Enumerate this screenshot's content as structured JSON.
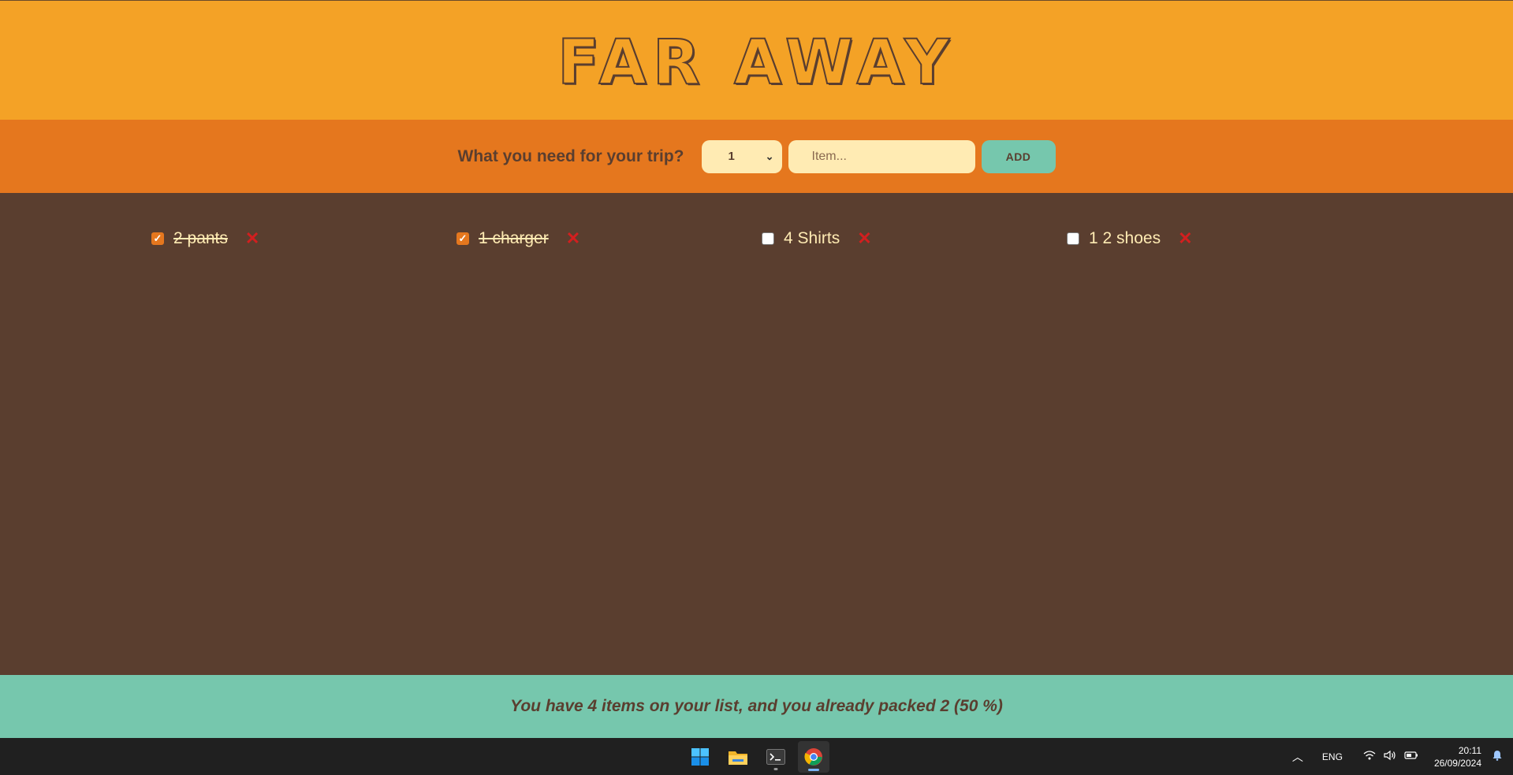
{
  "header": {
    "title": "FAR AWAY"
  },
  "form": {
    "prompt": "What you need for your trip?",
    "quantity": "1",
    "item_placeholder": "Item...",
    "add_label": "ADD"
  },
  "items": [
    {
      "label": "2 pants",
      "packed": true,
      "delete": "✕"
    },
    {
      "label": "1 charger",
      "packed": true,
      "delete": "✕"
    },
    {
      "label": "4 Shirts",
      "packed": false,
      "delete": "✕"
    },
    {
      "label": "1 2 shoes",
      "packed": false,
      "delete": "✕"
    }
  ],
  "stats": {
    "text": "You have 4 items on your list, and you already packed 2 (50 %)"
  },
  "taskbar": {
    "apps": [
      "windows-start-icon",
      "file-explorer-icon",
      "terminal-icon",
      "chrome-icon"
    ],
    "language": "ENG",
    "time": "20:11",
    "date": "26/09/2024"
  },
  "colors": {
    "header_bg": "#f4a226",
    "form_bg": "#e5771e",
    "list_bg": "#5a3e2f",
    "stats_bg": "#76c7ad",
    "text_light": "#ffebb3",
    "delete": "#d21f1f"
  }
}
